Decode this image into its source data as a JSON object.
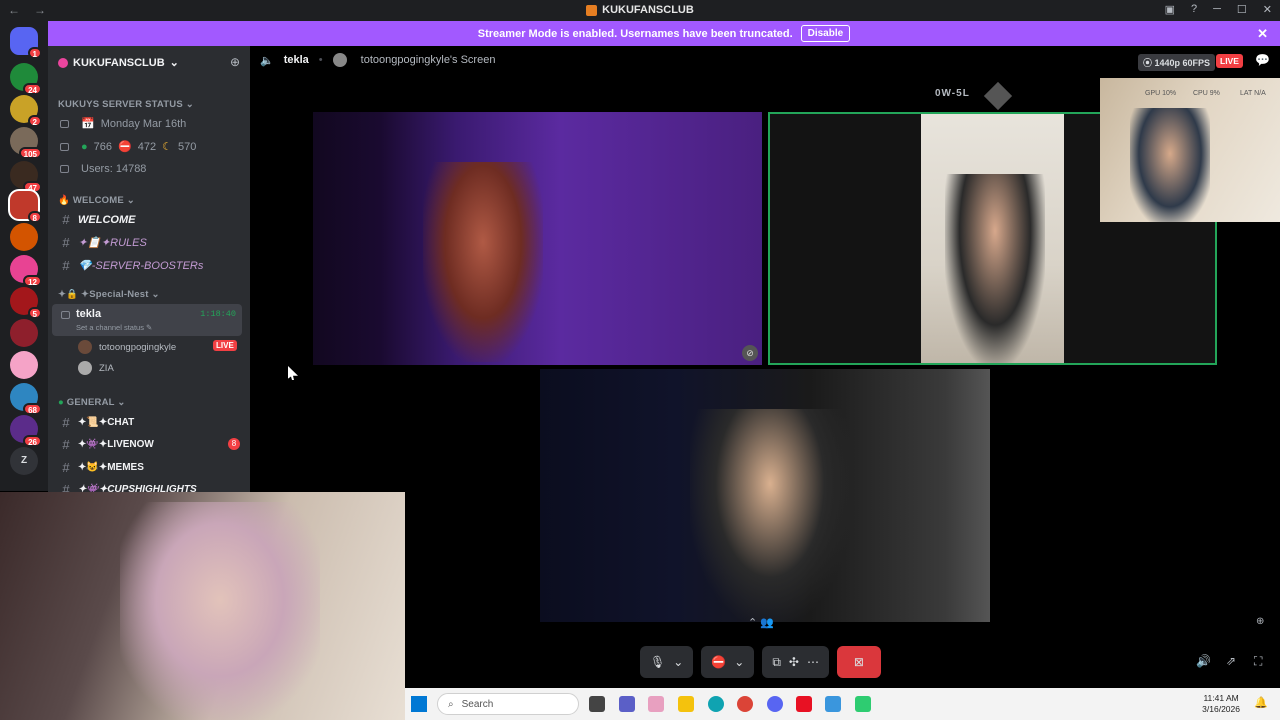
{
  "window": {
    "title": "KUKUFANSCLUB"
  },
  "banner": {
    "text": "Streamer Mode is enabled. Usernames have been truncated.",
    "button": "Disable"
  },
  "guild_badges": [
    "1",
    "24",
    "2",
    "105",
    "47",
    "8",
    "5",
    "12",
    "6",
    "68",
    "26"
  ],
  "server": {
    "name": "KUKUFANSCLUB"
  },
  "sidebar": {
    "status_category": "KUKUYS SERVER STATUS",
    "status_rows": [
      "Monday Mar 16th",
      "766",
      "472",
      "570",
      "Users: 14788"
    ],
    "welcome_category": "WELCOME",
    "welcome_channels": [
      "WELCOME",
      "✦📋✦RULES",
      "💎-SERVER-BOOSTERs"
    ],
    "special_category": "✦Special-Nest",
    "voice_channel": {
      "name": "tekla",
      "status": "Set a channel status",
      "time": "1:18:40"
    },
    "voice_users": [
      {
        "name": "totoongpogingkyle",
        "live": "LIVE"
      },
      {
        "name": "ZIA"
      }
    ],
    "general_category": "GENERAL",
    "general_channels": [
      {
        "label": "✦📜✦CHAT"
      },
      {
        "label": "✦👾✦LIVENOW",
        "badge": "8"
      },
      {
        "label": "✦😺✦MEMES"
      },
      {
        "label": "✦👾✦CUPSHIGHLIGHTS"
      }
    ]
  },
  "stage": {
    "channel": "tekla",
    "screen_label": "totoongpogingkyle's Screen",
    "quality": "1440p 60FPS",
    "live": "LIVE",
    "score": "0W-5L"
  },
  "overlay": {
    "gpu": "GPU 10%",
    "cpu": "CPU 9%",
    "lat": "LAT N/A"
  },
  "taskbar": {
    "search": "Search",
    "time": "11:41 AM",
    "date": "3/16/2026"
  },
  "colors": {
    "brand": "#a259ff",
    "live": "#f23f43",
    "online": "#23a559"
  }
}
